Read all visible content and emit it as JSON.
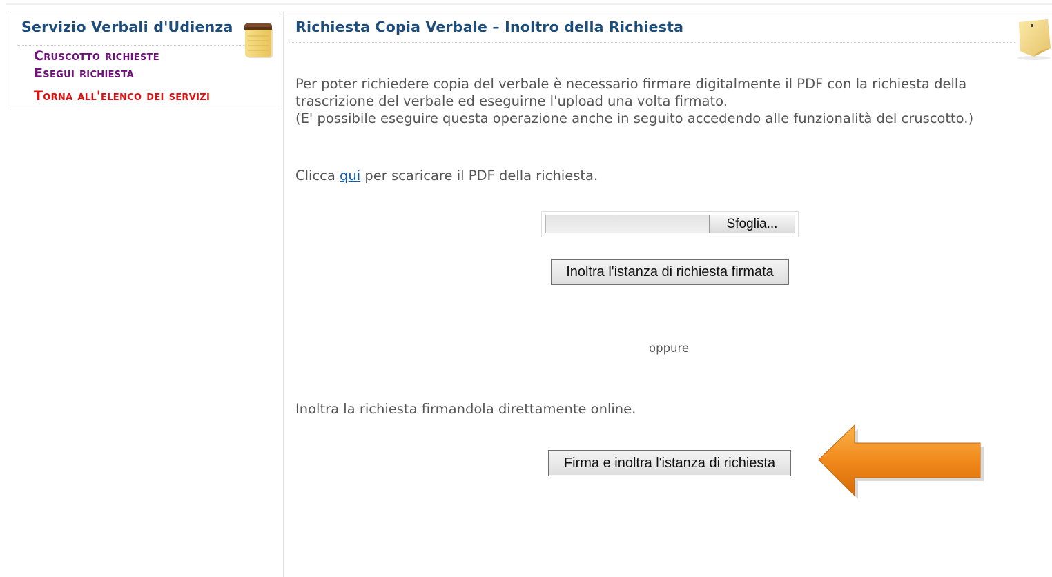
{
  "sidebar": {
    "title": "Servizio Verbali d'Udienza",
    "items": [
      {
        "label": "Cruscotto richieste"
      },
      {
        "label": "Esegui richiesta"
      },
      {
        "label": "Torna all'elenco dei servizi"
      }
    ],
    "icon": "notepad-icon"
  },
  "main": {
    "title": "Richiesta Copia Verbale – Inoltro della Richiesta",
    "icon": "sticky-note-icon",
    "intro_line1": "Per poter richiedere copia del verbale è necessario firmare digitalmente il PDF con la richiesta della",
    "intro_line2": "trascrizione del verbale ed eseguirne l'upload una volta firmato.",
    "intro_line3": "(E' possibile eseguire questa operazione anche in seguito accedendo alle funzionalità del cruscotto.)",
    "download_prefix": "Clicca ",
    "download_link": "qui",
    "download_suffix": " per scaricare il PDF della richiesta.",
    "file_input_value": "",
    "browse_label": "Sfoglia...",
    "send_signed_label": "Inoltra l'istanza di richiesta firmata",
    "or_label": "oppure",
    "online_text": "Inoltra la richiesta firmandola direttamente online.",
    "sign_send_label": "Firma e inoltra l'istanza di richiesta"
  },
  "colors": {
    "title_blue": "#1e4d7b",
    "nav_purple": "#70107a",
    "nav_red": "#e01010",
    "link_blue": "#1060b0",
    "arrow_orange": "#f08a1c"
  },
  "annotation": "orange-arrow-icon"
}
